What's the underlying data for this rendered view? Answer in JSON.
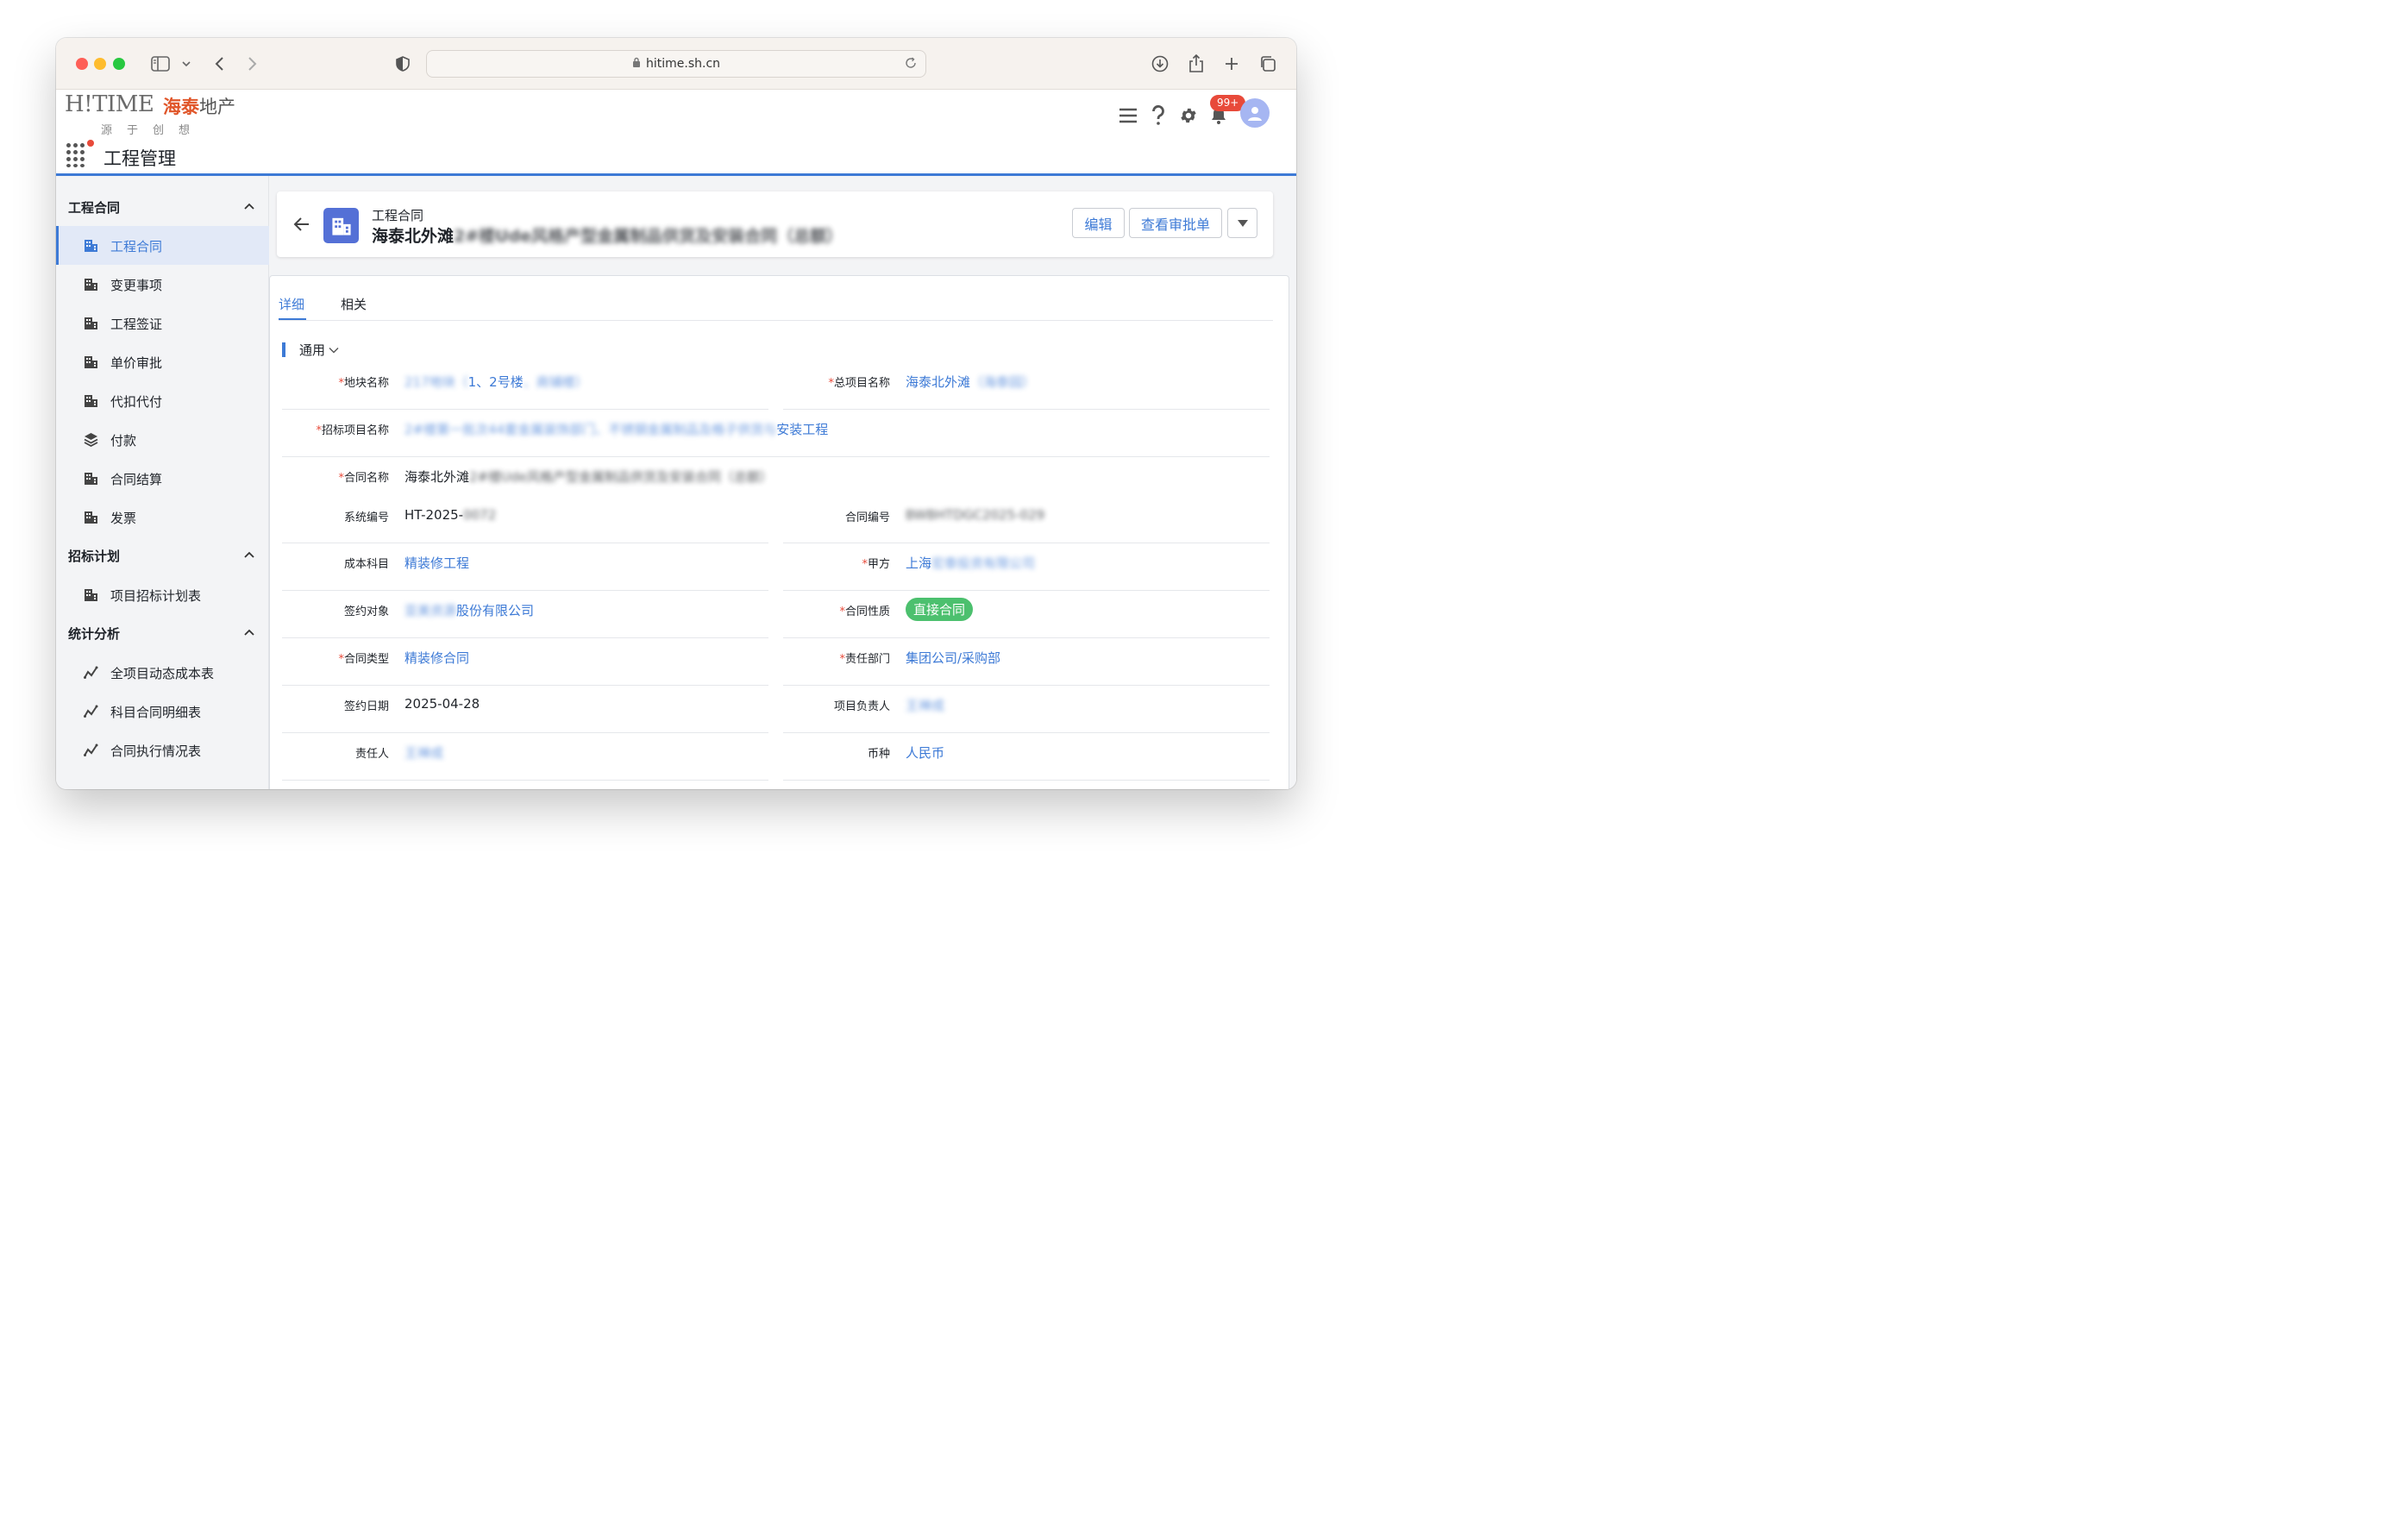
{
  "browser": {
    "url": "hitime.sh.cn"
  },
  "header": {
    "logo_text": "H!TIME",
    "logo_cn_brand": "海泰",
    "logo_cn_suffix": "地产",
    "slogan": "源于创想",
    "module_title": "工程管理",
    "notification_count": "99+"
  },
  "sidebar": {
    "sections": [
      {
        "title": "工程合同",
        "items": [
          {
            "label": "工程合同",
            "icon": "building-icon",
            "active": true
          },
          {
            "label": "变更事项",
            "icon": "building-icon"
          },
          {
            "label": "工程签证",
            "icon": "building-icon"
          },
          {
            "label": "单价审批",
            "icon": "building-icon"
          },
          {
            "label": "代扣代付",
            "icon": "building-icon"
          },
          {
            "label": "付款",
            "icon": "layers-icon"
          },
          {
            "label": "合同结算",
            "icon": "building-icon"
          },
          {
            "label": "发票",
            "icon": "building-icon"
          }
        ]
      },
      {
        "title": "招标计划",
        "items": [
          {
            "label": "项目招标计划表",
            "icon": "building-icon"
          }
        ]
      },
      {
        "title": "统计分析",
        "items": [
          {
            "label": "全项目动态成本表",
            "icon": "trend-icon"
          },
          {
            "label": "科目合同明细表",
            "icon": "trend-icon"
          },
          {
            "label": "合同执行情况表",
            "icon": "trend-icon"
          }
        ]
      }
    ]
  },
  "record": {
    "type_label": "工程合同",
    "title_visible": "海泰北外滩",
    "title_blurred": "2#楼Ude风格产型金属制品供货及安装合同（总额）",
    "buttons": {
      "edit": "编辑",
      "view_approval": "查看审批单"
    }
  },
  "tabs": [
    {
      "label": "详细",
      "active": true
    },
    {
      "label": "相关",
      "active": false
    }
  ],
  "section": {
    "title": "通用"
  },
  "fields": {
    "plot_name": {
      "label": "地块名称",
      "required": true,
      "value_blurred_pre": "217地块（",
      "value_visible": "1、2号楼",
      "value_blurred_post": "、商铺楼）"
    },
    "total_project": {
      "label": "总项目名称",
      "required": true,
      "value_visible": "海泰北外滩",
      "value_blurred_post": "（海泰园）"
    },
    "bid_project": {
      "label": "招标项目名称",
      "required": true,
      "value_blurred_pre": "2#楼第一批次44套金属装饰部门、不锈钢金属制品及格子供货与",
      "value_visible": "安装工程"
    },
    "contract_name": {
      "label": "合同名称",
      "required": true,
      "value_visible": "海泰北外滩",
      "value_blurred_post": "2#楼Ude风格产型金属制品供货及安装合同（总额）"
    },
    "system_no": {
      "label": "系统编号",
      "required": false,
      "value_visible": "HT-2025-",
      "value_blurred_post": "0072"
    },
    "contract_no": {
      "label": "合同编号",
      "required": false,
      "value_blurred_pre": "BWBHTDGC2025-029"
    },
    "cost_subject": {
      "label": "成本科目",
      "required": false,
      "value_visible": "精装修工程"
    },
    "party_a": {
      "label": "甲方",
      "required": true,
      "value_visible": "上海",
      "value_blurred_post": "宏泰投资有限公司"
    },
    "counterparty": {
      "label": "签约对象",
      "required": false,
      "value_blurred_pre": "亚美资源",
      "value_visible": "股份有限公司"
    },
    "contract_nature": {
      "label": "合同性质",
      "required": true,
      "value_visible": "直接合同"
    },
    "contract_type": {
      "label": "合同类型",
      "required": true,
      "value_visible": "精装修合同"
    },
    "department": {
      "label": "责任部门",
      "required": true,
      "value_visible": "集团公司/采购部"
    },
    "sign_date": {
      "label": "签约日期",
      "required": false,
      "value_visible": "2025-04-28"
    },
    "project_lead": {
      "label": "项目负责人",
      "required": false,
      "value_blurred_pre": "王禅成"
    },
    "responsible": {
      "label": "责任人",
      "required": false,
      "value_blurred_pre": "王禅成"
    },
    "currency": {
      "label": "币种",
      "required": false,
      "value_visible": "人民币"
    }
  },
  "colors": {
    "accent": "#3d7ad6",
    "badge_red": "#e84a3a",
    "pill_green": "#4cc06e",
    "record_icon_bg": "#5470d6"
  }
}
